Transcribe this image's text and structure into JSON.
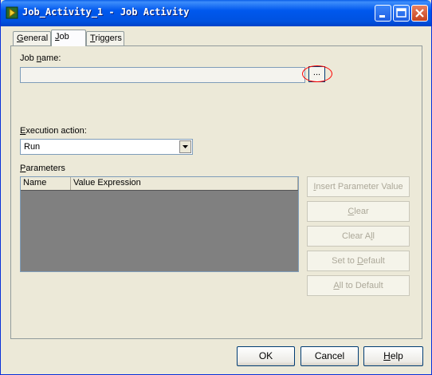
{
  "window": {
    "title": "Job_Activity_1 - Job Activity"
  },
  "tabs": [
    {
      "label": "General",
      "accel": "G",
      "rest": "eneral"
    },
    {
      "label": "Job",
      "accel": "J",
      "rest": "ob"
    },
    {
      "label": "Triggers",
      "accel": "T",
      "rest": "riggers"
    }
  ],
  "job_name": {
    "label_pre": "Job ",
    "accel": "n",
    "label_post": "ame:",
    "value": "",
    "browse_label": "..."
  },
  "execution": {
    "label_accel": "E",
    "label_rest": "xecution action:",
    "value": "Run"
  },
  "parameters": {
    "label_accel": "P",
    "label_rest": "arameters",
    "columns": [
      "Name",
      "Value Expression"
    ]
  },
  "side_buttons": [
    {
      "accel": "I",
      "rest": "nsert Parameter Value"
    },
    {
      "accel": "C",
      "rest": "lear"
    },
    {
      "pre": "Clear A",
      "accel": "l",
      "post": "l"
    },
    {
      "pre": "Set to ",
      "accel": "D",
      "post": "efault"
    },
    {
      "accel": "A",
      "rest": "ll to Default"
    }
  ],
  "footer": {
    "ok": "OK",
    "cancel": "Cancel",
    "help_accel": "H",
    "help_rest": "elp"
  }
}
